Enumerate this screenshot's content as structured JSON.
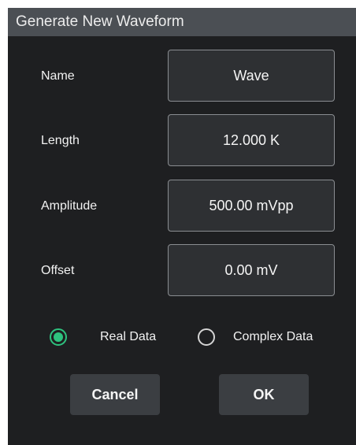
{
  "dialog": {
    "title": "Generate New Waveform"
  },
  "fields": {
    "name": {
      "label": "Name",
      "value": "Wave"
    },
    "length": {
      "label": "Length",
      "value": "12.000 K"
    },
    "amplitude": {
      "label": "Amplitude",
      "value": "500.00 mVpp"
    },
    "offset": {
      "label": "Offset",
      "value": "0.00 mV"
    }
  },
  "data_type": {
    "options": [
      {
        "label": "Real Data",
        "selected": true
      },
      {
        "label": "Complex Data",
        "selected": false
      }
    ]
  },
  "buttons": {
    "cancel": "Cancel",
    "ok": "OK"
  },
  "colors": {
    "accent": "#2ec27e",
    "background": "#1e1f21",
    "titlebar": "#4b4f54",
    "field_bg": "#2e3033",
    "button_bg": "#3b3e42"
  }
}
